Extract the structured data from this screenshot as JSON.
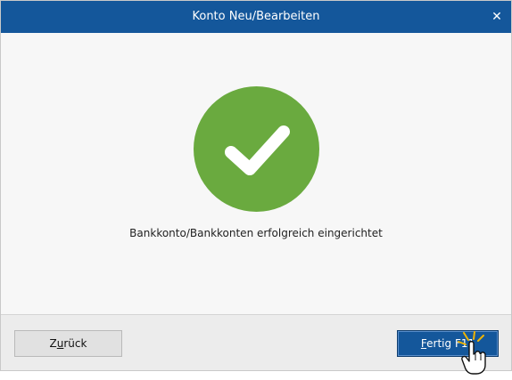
{
  "window": {
    "title": "Konto Neu/Bearbeiten",
    "close_symbol": "✕"
  },
  "content": {
    "icon": "success-check-icon",
    "message": "Bankkonto/Bankkonten erfolgreich eingerichtet"
  },
  "footer": {
    "back_button": {
      "label_prefix": "Z",
      "label_underlined": "u",
      "label_suffix": "rück"
    },
    "finish_button": {
      "label_underlined": "F",
      "label_suffix": "ertig",
      "shortcut": "F11"
    }
  },
  "colors": {
    "titlebar": "#14579b",
    "success": "#6aaa3f",
    "primary_button": "#14579b"
  }
}
